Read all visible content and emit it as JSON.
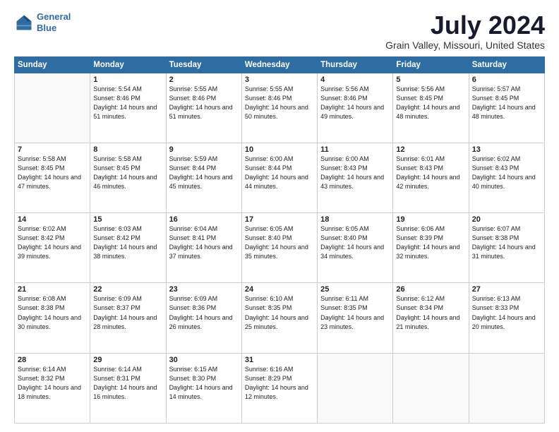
{
  "logo": {
    "line1": "General",
    "line2": "Blue"
  },
  "title": "July 2024",
  "subtitle": "Grain Valley, Missouri, United States",
  "weekdays": [
    "Sunday",
    "Monday",
    "Tuesday",
    "Wednesday",
    "Thursday",
    "Friday",
    "Saturday"
  ],
  "weeks": [
    [
      {
        "day": null,
        "sunrise": null,
        "sunset": null,
        "daylight": null
      },
      {
        "day": "1",
        "sunrise": "Sunrise: 5:54 AM",
        "sunset": "Sunset: 8:46 PM",
        "daylight": "Daylight: 14 hours and 51 minutes."
      },
      {
        "day": "2",
        "sunrise": "Sunrise: 5:55 AM",
        "sunset": "Sunset: 8:46 PM",
        "daylight": "Daylight: 14 hours and 51 minutes."
      },
      {
        "day": "3",
        "sunrise": "Sunrise: 5:55 AM",
        "sunset": "Sunset: 8:46 PM",
        "daylight": "Daylight: 14 hours and 50 minutes."
      },
      {
        "day": "4",
        "sunrise": "Sunrise: 5:56 AM",
        "sunset": "Sunset: 8:46 PM",
        "daylight": "Daylight: 14 hours and 49 minutes."
      },
      {
        "day": "5",
        "sunrise": "Sunrise: 5:56 AM",
        "sunset": "Sunset: 8:45 PM",
        "daylight": "Daylight: 14 hours and 48 minutes."
      },
      {
        "day": "6",
        "sunrise": "Sunrise: 5:57 AM",
        "sunset": "Sunset: 8:45 PM",
        "daylight": "Daylight: 14 hours and 48 minutes."
      }
    ],
    [
      {
        "day": "7",
        "sunrise": "Sunrise: 5:58 AM",
        "sunset": "Sunset: 8:45 PM",
        "daylight": "Daylight: 14 hours and 47 minutes."
      },
      {
        "day": "8",
        "sunrise": "Sunrise: 5:58 AM",
        "sunset": "Sunset: 8:45 PM",
        "daylight": "Daylight: 14 hours and 46 minutes."
      },
      {
        "day": "9",
        "sunrise": "Sunrise: 5:59 AM",
        "sunset": "Sunset: 8:44 PM",
        "daylight": "Daylight: 14 hours and 45 minutes."
      },
      {
        "day": "10",
        "sunrise": "Sunrise: 6:00 AM",
        "sunset": "Sunset: 8:44 PM",
        "daylight": "Daylight: 14 hours and 44 minutes."
      },
      {
        "day": "11",
        "sunrise": "Sunrise: 6:00 AM",
        "sunset": "Sunset: 8:43 PM",
        "daylight": "Daylight: 14 hours and 43 minutes."
      },
      {
        "day": "12",
        "sunrise": "Sunrise: 6:01 AM",
        "sunset": "Sunset: 8:43 PM",
        "daylight": "Daylight: 14 hours and 42 minutes."
      },
      {
        "day": "13",
        "sunrise": "Sunrise: 6:02 AM",
        "sunset": "Sunset: 8:43 PM",
        "daylight": "Daylight: 14 hours and 40 minutes."
      }
    ],
    [
      {
        "day": "14",
        "sunrise": "Sunrise: 6:02 AM",
        "sunset": "Sunset: 8:42 PM",
        "daylight": "Daylight: 14 hours and 39 minutes."
      },
      {
        "day": "15",
        "sunrise": "Sunrise: 6:03 AM",
        "sunset": "Sunset: 8:42 PM",
        "daylight": "Daylight: 14 hours and 38 minutes."
      },
      {
        "day": "16",
        "sunrise": "Sunrise: 6:04 AM",
        "sunset": "Sunset: 8:41 PM",
        "daylight": "Daylight: 14 hours and 37 minutes."
      },
      {
        "day": "17",
        "sunrise": "Sunrise: 6:05 AM",
        "sunset": "Sunset: 8:40 PM",
        "daylight": "Daylight: 14 hours and 35 minutes."
      },
      {
        "day": "18",
        "sunrise": "Sunrise: 6:05 AM",
        "sunset": "Sunset: 8:40 PM",
        "daylight": "Daylight: 14 hours and 34 minutes."
      },
      {
        "day": "19",
        "sunrise": "Sunrise: 6:06 AM",
        "sunset": "Sunset: 8:39 PM",
        "daylight": "Daylight: 14 hours and 32 minutes."
      },
      {
        "day": "20",
        "sunrise": "Sunrise: 6:07 AM",
        "sunset": "Sunset: 8:38 PM",
        "daylight": "Daylight: 14 hours and 31 minutes."
      }
    ],
    [
      {
        "day": "21",
        "sunrise": "Sunrise: 6:08 AM",
        "sunset": "Sunset: 8:38 PM",
        "daylight": "Daylight: 14 hours and 30 minutes."
      },
      {
        "day": "22",
        "sunrise": "Sunrise: 6:09 AM",
        "sunset": "Sunset: 8:37 PM",
        "daylight": "Daylight: 14 hours and 28 minutes."
      },
      {
        "day": "23",
        "sunrise": "Sunrise: 6:09 AM",
        "sunset": "Sunset: 8:36 PM",
        "daylight": "Daylight: 14 hours and 26 minutes."
      },
      {
        "day": "24",
        "sunrise": "Sunrise: 6:10 AM",
        "sunset": "Sunset: 8:35 PM",
        "daylight": "Daylight: 14 hours and 25 minutes."
      },
      {
        "day": "25",
        "sunrise": "Sunrise: 6:11 AM",
        "sunset": "Sunset: 8:35 PM",
        "daylight": "Daylight: 14 hours and 23 minutes."
      },
      {
        "day": "26",
        "sunrise": "Sunrise: 6:12 AM",
        "sunset": "Sunset: 8:34 PM",
        "daylight": "Daylight: 14 hours and 21 minutes."
      },
      {
        "day": "27",
        "sunrise": "Sunrise: 6:13 AM",
        "sunset": "Sunset: 8:33 PM",
        "daylight": "Daylight: 14 hours and 20 minutes."
      }
    ],
    [
      {
        "day": "28",
        "sunrise": "Sunrise: 6:14 AM",
        "sunset": "Sunset: 8:32 PM",
        "daylight": "Daylight: 14 hours and 18 minutes."
      },
      {
        "day": "29",
        "sunrise": "Sunrise: 6:14 AM",
        "sunset": "Sunset: 8:31 PM",
        "daylight": "Daylight: 14 hours and 16 minutes."
      },
      {
        "day": "30",
        "sunrise": "Sunrise: 6:15 AM",
        "sunset": "Sunset: 8:30 PM",
        "daylight": "Daylight: 14 hours and 14 minutes."
      },
      {
        "day": "31",
        "sunrise": "Sunrise: 6:16 AM",
        "sunset": "Sunset: 8:29 PM",
        "daylight": "Daylight: 14 hours and 12 minutes."
      },
      {
        "day": null,
        "sunrise": null,
        "sunset": null,
        "daylight": null
      },
      {
        "day": null,
        "sunrise": null,
        "sunset": null,
        "daylight": null
      },
      {
        "day": null,
        "sunrise": null,
        "sunset": null,
        "daylight": null
      }
    ]
  ]
}
